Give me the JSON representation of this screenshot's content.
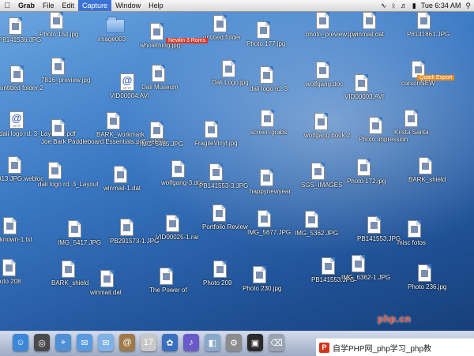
{
  "menubar": {
    "app_name": "Grab",
    "items": [
      "File",
      "Edit",
      "Capture",
      "Window",
      "Help"
    ],
    "active_item": "Capture",
    "time": "Tue 6:34 AM"
  },
  "desktop": {
    "icons": [
      {
        "kind": "doc",
        "label": "P8141536.JPG"
      },
      {
        "kind": "doc",
        "label": "Photo 154.jpg"
      },
      {
        "kind": "folder",
        "label": "image003"
      },
      {
        "kind": "doc",
        "label": "wholething.jpg"
      },
      {
        "kind": "doc",
        "label": "untitled folder"
      },
      {
        "kind": "doc",
        "label": "Photo 177.jpg"
      },
      {
        "kind": "doc",
        "label": "photo_preview.jpg"
      },
      {
        "kind": "doc",
        "label": "winmail.dat"
      },
      {
        "kind": "doc",
        "label": "P8141861.JPG"
      },
      {
        "kind": "doc",
        "label": "untitled folder 2"
      },
      {
        "kind": "doc",
        "label": "7816_preview.jpg"
      },
      {
        "kind": "webloc",
        "label": "VID00004.AVI"
      },
      {
        "kind": "doc",
        "label": "Dali Museum"
      },
      {
        "kind": "doc",
        "label": "Dali Logo.jpg"
      },
      {
        "kind": "doc",
        "label": "dali logo rd. 3"
      },
      {
        "kind": "doc",
        "label": "wolfgang.doc"
      },
      {
        "kind": "doc",
        "label": "VID00003.AVI"
      },
      {
        "kind": "doc",
        "label": "carsonNEW"
      },
      {
        "kind": "webloc",
        "label": "dali logo rd. 3_Layout 1.pdf"
      },
      {
        "kind": "doc",
        "label": "Joe Bark Paddleboard Essentials.pdf.webloc"
      },
      {
        "kind": "doc",
        "label": "BARK_workmark"
      },
      {
        "kind": "doc",
        "label": "IMG_5485.JPG"
      },
      {
        "kind": "doc",
        "label": "FragileVinyl.jpg"
      },
      {
        "kind": "doc",
        "label": "screen grabs"
      },
      {
        "kind": "doc",
        "label": "wolfgang book 2"
      },
      {
        "kind": "doc",
        "label": "Photo Impression"
      },
      {
        "kind": "doc",
        "label": "Krista Sarita"
      },
      {
        "kind": "doc",
        "label": "013.JPG.webloc"
      },
      {
        "kind": "doc",
        "label": "dali logo rd. 3_Layout"
      },
      {
        "kind": "doc",
        "label": "winmail-1.dat"
      },
      {
        "kind": "doc",
        "label": "wolfgang-3.doc"
      },
      {
        "kind": "doc",
        "label": "PB141553-3.JPG"
      },
      {
        "kind": "doc",
        "label": "happynewyear"
      },
      {
        "kind": "doc",
        "label": "SGS_IMAGES"
      },
      {
        "kind": "doc",
        "label": "Photo 172.jpg"
      },
      {
        "kind": "doc",
        "label": "BARK_shield"
      },
      {
        "kind": "doc",
        "label": "unknown-1.txt"
      },
      {
        "kind": "doc",
        "label": "IMG_5417.JPG"
      },
      {
        "kind": "doc",
        "label": "PB291573-1.JPG"
      },
      {
        "kind": "doc",
        "label": "VID00025-1.rar"
      },
      {
        "kind": "doc",
        "label": "Portfolio Review"
      },
      {
        "kind": "doc",
        "label": "IMG_5677.JPG"
      },
      {
        "kind": "doc",
        "label": "IMG_5362.JPG"
      },
      {
        "kind": "doc",
        "label": "PB141553.JPG"
      },
      {
        "kind": "doc",
        "label": "misc fotos"
      },
      {
        "kind": "doc",
        "label": "Photo 208"
      },
      {
        "kind": "doc",
        "label": "BARK_shield"
      },
      {
        "kind": "doc",
        "label": "winmail.dat"
      },
      {
        "kind": "doc",
        "label": "The Power of"
      },
      {
        "kind": "doc",
        "label": "Photo 209"
      },
      {
        "kind": "doc",
        "label": "Photo 230.jpg"
      },
      {
        "kind": "doc",
        "label": "PB141553.JPG"
      },
      {
        "kind": "doc",
        "label": "IMG_6362-1.JPG"
      },
      {
        "kind": "doc",
        "label": "Photo 236.jpg"
      }
    ],
    "tags": {
      "red": "Newlin 3 Roms",
      "orange": "Quark Export"
    }
  },
  "dock": {
    "icons": [
      "finder",
      "dashboard",
      "safari",
      "ichat",
      "mail",
      "address-book",
      "ical",
      "iphoto",
      "itunes",
      "preview",
      "system-prefs",
      "terminal",
      "trash"
    ]
  },
  "watermark": {
    "site": "php.cn",
    "text": "自学PHP网_php学习_php教"
  }
}
